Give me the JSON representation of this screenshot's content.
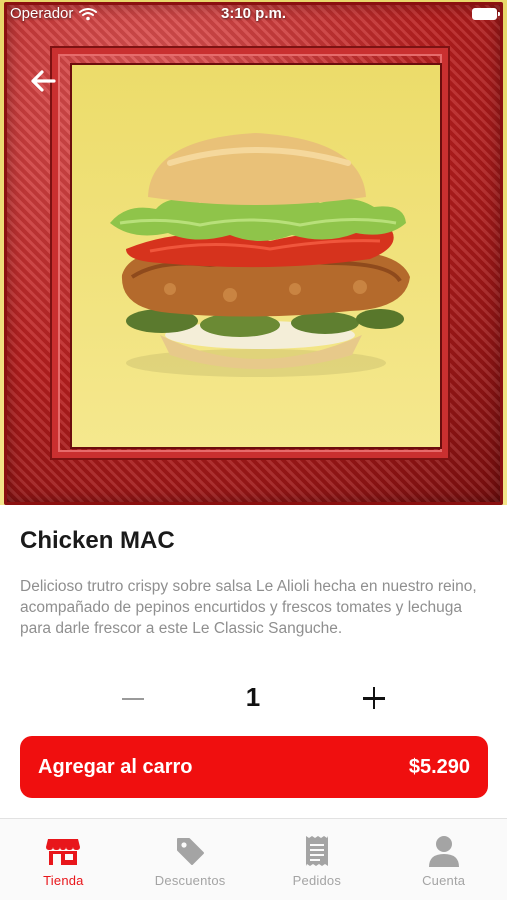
{
  "status_bar": {
    "carrier": "Operador",
    "time": "3:10 p.m."
  },
  "product": {
    "name": "Chicken MAC",
    "description": "Delicioso trutro crispy sobre salsa Le Alioli hecha en nuestro reino, acompañado de pepinos encurtidos y frescos tomates y lechuga para darle frescor a este Le Classic Sanguche."
  },
  "quantity": {
    "value": "1"
  },
  "cart_button": {
    "label": "Agregar al carro",
    "price": "$5.290"
  },
  "tabs": [
    {
      "label": "Tienda",
      "icon": "store-icon",
      "active": true
    },
    {
      "label": "Descuentos",
      "icon": "tag-icon",
      "active": false
    },
    {
      "label": "Pedidos",
      "icon": "receipt-icon",
      "active": false
    },
    {
      "label": "Cuenta",
      "icon": "user-icon",
      "active": false
    }
  ],
  "colors": {
    "accent": "#f00f0f",
    "tab_active": "#e8161b",
    "tab_inactive": "#a4a4a4"
  }
}
